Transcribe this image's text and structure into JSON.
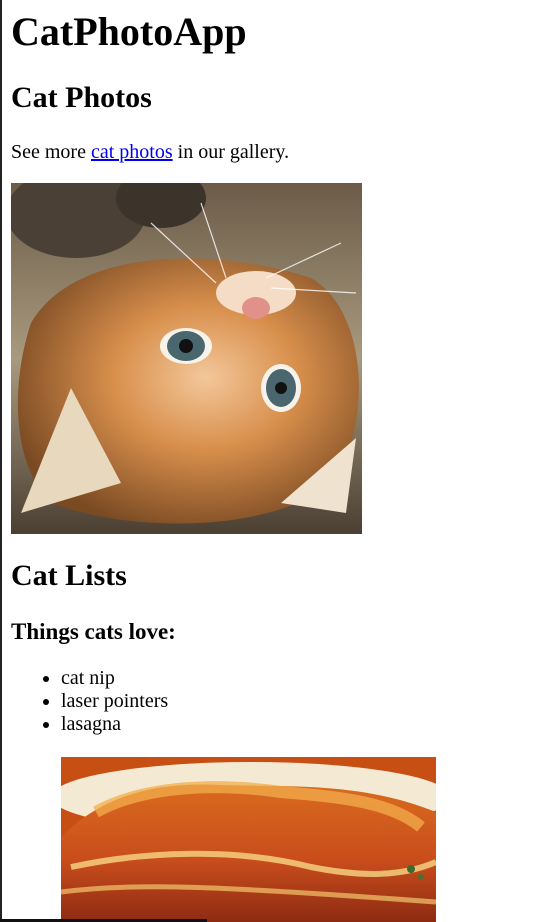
{
  "header": {
    "app_title": "CatPhotoApp"
  },
  "main": {
    "photos_section": {
      "heading": "Cat Photos",
      "gallery_prefix": "See more ",
      "gallery_link": "cat photos",
      "gallery_suffix": " in our gallery."
    },
    "lists_section": {
      "heading": "Cat Lists",
      "list_title": "Things cats love:",
      "items": [
        "cat nip",
        "laser pointers",
        "lasagna"
      ]
    }
  },
  "colors": {
    "link": "#0000ee",
    "text": "#000000",
    "background": "#ffffff"
  }
}
